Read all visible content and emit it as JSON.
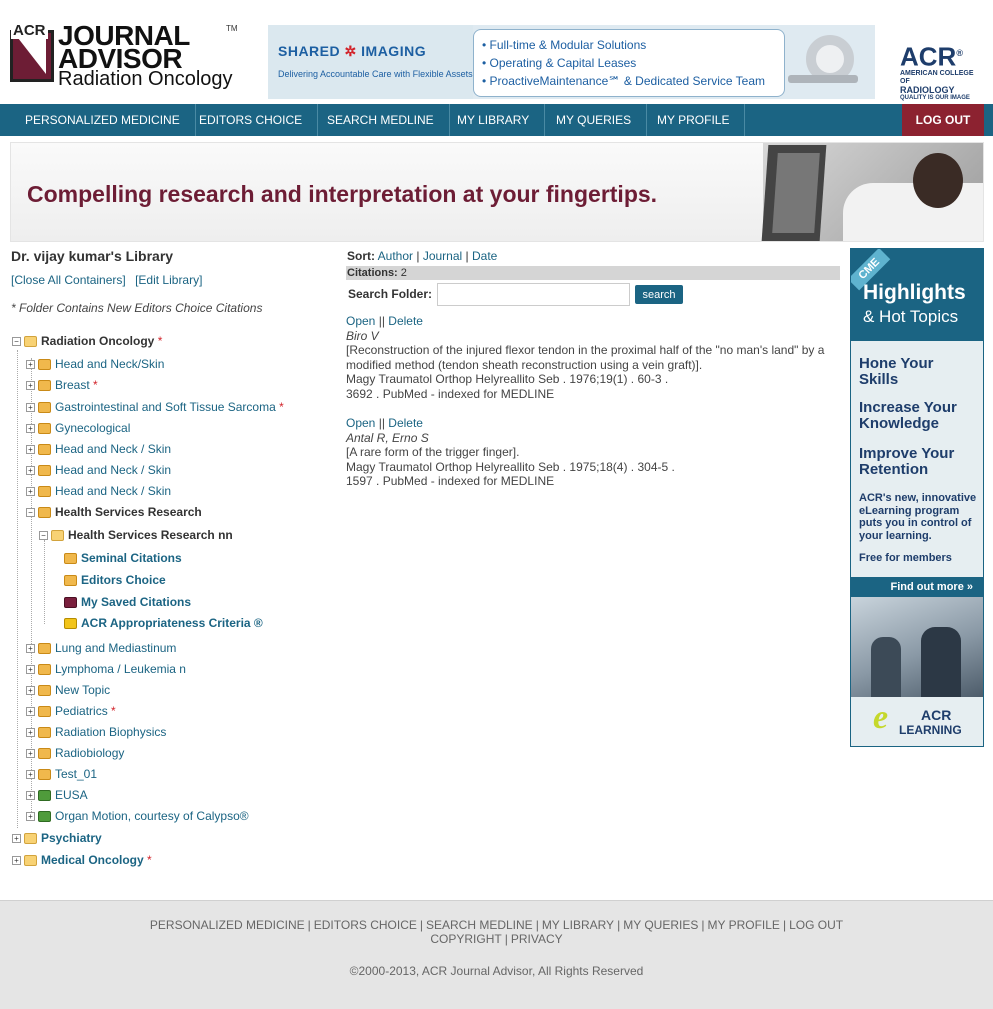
{
  "header": {
    "logo": {
      "acr": "ACR",
      "line1": "JOURNAL",
      "line2": "ADVISOR",
      "line3": "Radiation Oncology",
      "tm": "TM"
    },
    "ad": {
      "brand_left": "SHARED",
      "brand_right": "IMAGING",
      "tagline": "Delivering Accountable Care with Flexible Assets",
      "lines": [
        "• Full-time & Modular Solutions",
        "• Operating & Capital Leases",
        "• ProactiveMaintenance℠ & Dedicated Service Team"
      ]
    },
    "acr_logo": {
      "big": "ACR",
      "reg": "®",
      "sub1": "AMERICAN COLLEGE OF",
      "sub2": "RADIOLOGY",
      "sub3": "QUALITY IS OUR IMAGE"
    }
  },
  "nav": {
    "items": [
      "PERSONALIZED MEDICINE",
      "EDITORS CHOICE",
      "SEARCH MEDLINE",
      "MY LIBRARY",
      "MY QUERIES",
      "MY PROFILE"
    ],
    "logout": "LOG OUT"
  },
  "hero": {
    "text": "Compelling research and interpretation at your fingertips."
  },
  "library": {
    "title": "Dr. vijay kumar's Library",
    "close_all": "[Close All Containers]",
    "edit": "[Edit Library]",
    "note": "* Folder Contains New Editors Choice Citations",
    "tree": [
      {
        "label": "Radiation Oncology",
        "star": "*"
      },
      {
        "label": "Head and Neck/Skin",
        "star": ""
      },
      {
        "label": "Breast",
        "star": "*"
      },
      {
        "label": "Gastrointestinal and Soft Tissue Sarcoma",
        "star": "*"
      },
      {
        "label": "Gynecological",
        "star": ""
      },
      {
        "label": "Head and Neck / Skin",
        "star": ""
      },
      {
        "label": "Head and Neck / Skin",
        "star": ""
      },
      {
        "label": "Head and Neck / Skin",
        "star": ""
      },
      {
        "label": "Health Services Research",
        "star": ""
      },
      {
        "label": "Health Services Research nn",
        "star": ""
      },
      {
        "label": "Seminal Citations",
        "star": ""
      },
      {
        "label": "Editors Choice",
        "star": ""
      },
      {
        "label": "My Saved Citations",
        "star": ""
      },
      {
        "label": "ACR Appropriateness Criteria ®",
        "star": ""
      },
      {
        "label": "Lung and Mediastinum",
        "star": ""
      },
      {
        "label": "Lymphoma / Leukemia n",
        "star": ""
      },
      {
        "label": "New Topic",
        "star": ""
      },
      {
        "label": "Pediatrics",
        "star": "*"
      },
      {
        "label": "Radiation Biophysics",
        "star": ""
      },
      {
        "label": "Radiobiology",
        "star": ""
      },
      {
        "label": "Test_01",
        "star": ""
      },
      {
        "label": "EUSA",
        "star": ""
      },
      {
        "label": "Organ Motion, courtesy of Calypso®",
        "star": ""
      },
      {
        "label": "Psychiatry",
        "star": ""
      },
      {
        "label": "Medical Oncology",
        "star": "*"
      }
    ]
  },
  "content": {
    "sort_label": "Sort:",
    "sort_options": [
      "Author",
      "Journal",
      "Date"
    ],
    "citations_label": "Citations:",
    "citations_count": "2",
    "search_label": "Search Folder:",
    "search_value": "",
    "search_button": "search",
    "citations": [
      {
        "open": "Open",
        "sep": "||",
        "delete": "Delete",
        "author": "Biro V",
        "title": "[Reconstruction of the injured flexor tendon in the proximal half of the \"no man's land\" by a modified method (tendon sheath reconstruction using a vein graft)].",
        "source": "Magy Traumatol Orthop Helyreallito Seb . 1976;19(1) . 60-3 .",
        "pmid": "3692 . PubMed - indexed for MEDLINE"
      },
      {
        "open": "Open",
        "sep": "||",
        "delete": "Delete",
        "author": "Antal R, Erno S",
        "title": "[A rare form of the trigger finger].",
        "source": "Magy Traumatol Orthop Helyreallito Seb . 1975;18(4) . 304-5 .",
        "pmid": "1597 . PubMed - indexed for MEDLINE"
      }
    ]
  },
  "cme_ad": {
    "tag": "CME",
    "h1": "Highlights",
    "h2": "& Hot Topics",
    "lines": [
      "Hone Your\nSkills",
      "Increase Your\nKnowledge",
      "Improve Your\nRetention"
    ],
    "desc": "ACR's new, innovative eLearning program puts you in control of your learning.",
    "free": "Free for members",
    "find": "Find out more »",
    "e": "e",
    "acr": "ACR",
    "learning": "LEARNING"
  },
  "footer": {
    "links": [
      "PERSONALIZED MEDICINE",
      "EDITORS CHOICE",
      "SEARCH MEDLINE",
      "MY LIBRARY",
      "MY QUERIES",
      "MY PROFILE",
      "LOG OUT"
    ],
    "links2": [
      "COPYRIGHT",
      "PRIVACY"
    ],
    "sep": "|",
    "copyright": "©2000-2013, ACR Journal Advisor, All Rights Reserved"
  },
  "colors": {
    "nav": "#1b6483",
    "logout": "#8c2230",
    "hero_text": "#6d1d35",
    "link": "#1b6483"
  }
}
